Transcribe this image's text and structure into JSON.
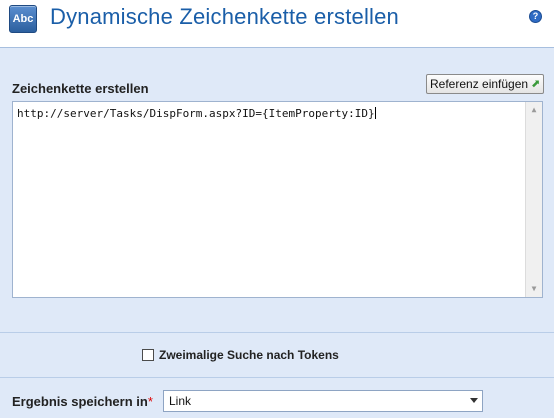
{
  "header": {
    "app_icon_text": "Abc",
    "title": "Dynamische Zeichenkette erstellen",
    "help_icon": "?"
  },
  "section_create": {
    "title": "Zeichenkette erstellen",
    "reference_button_label": "Referenz einfügen",
    "text_value": "http://server/Tasks/DispForm.aspx?ID={ItemProperty:ID}"
  },
  "options": {
    "double_token_search_label": "Zweimalige Suche nach Tokens",
    "double_token_search_checked": false
  },
  "result": {
    "label": "Ergebnis speichern in",
    "required_marker": "*",
    "selected_value": "Link"
  },
  "icons": {
    "app": "abc-icon",
    "help": "help-icon",
    "insert_reference": "insert-reference-icon",
    "dropdown": "chevron-down-icon"
  },
  "colors": {
    "title": "#1a5ea8",
    "panel_background": "#dfe9f8",
    "required": "#dd0000"
  }
}
